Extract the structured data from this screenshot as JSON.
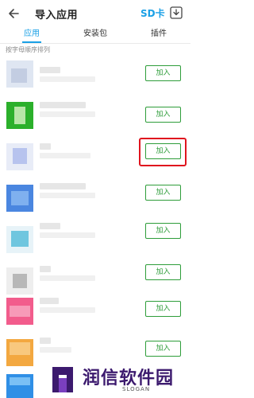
{
  "header": {
    "title": "导入应用",
    "sd_label": "SD卡",
    "back_icon": "arrow-left-icon",
    "download_icon": "download-icon"
  },
  "tabs": [
    {
      "label": "应用",
      "active": true
    },
    {
      "label": "安装包",
      "active": false
    },
    {
      "label": "插件",
      "active": false
    }
  ],
  "sort_label": "按字母顺序排列",
  "add_label": "加入",
  "colors": {
    "accent": "#1aa0e6",
    "add_button": "#2e9d3a",
    "highlight": "#e0141e"
  },
  "watermark": {
    "name": "润信软件园",
    "slogan": "SLOGAN"
  }
}
